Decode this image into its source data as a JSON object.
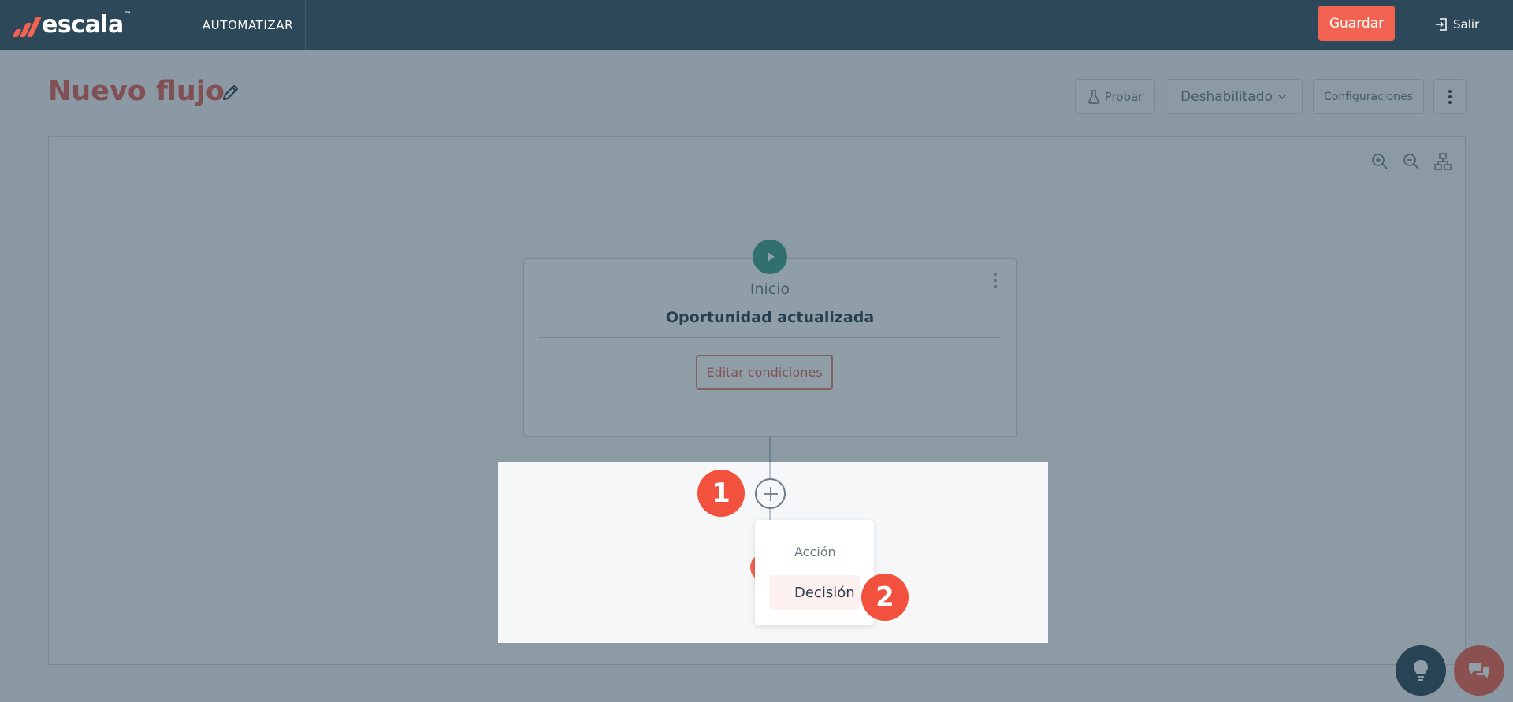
{
  "topbar": {
    "brand": "escala",
    "brand_tm": "™",
    "nav_label": "AUTOMATIZAR",
    "save_label": "Guardar",
    "exit_label": "Salir",
    "colors": {
      "bar": "#2c4859",
      "accent": "#f26451"
    }
  },
  "header": {
    "title": "Nuevo flujo",
    "test_label": "Probar",
    "status_label": "Deshabilitado",
    "config_label": "Configuraciones"
  },
  "flow": {
    "start_node": {
      "label": "Inicio",
      "trigger": "Oportunidad actualizada",
      "edit_conditions_label": "Editar condiciones"
    },
    "add_menu": {
      "items": [
        "Acción",
        "Decisión"
      ],
      "highlighted": "Decisión"
    }
  },
  "tutorial": {
    "step_1": "1",
    "step_2": "2"
  },
  "icons": {
    "edit": "pencil-icon",
    "test": "flask-icon",
    "status": "chevron-down-icon",
    "more": "vertical-dots-icon",
    "zoom_in": "zoom-in-icon",
    "zoom_out": "zoom-out-icon",
    "layout": "hierarchy-icon",
    "play": "play-icon",
    "add": "plus-circle-icon",
    "tips": "lightbulb-icon",
    "chat": "chat-icon",
    "exit": "logout-icon"
  }
}
